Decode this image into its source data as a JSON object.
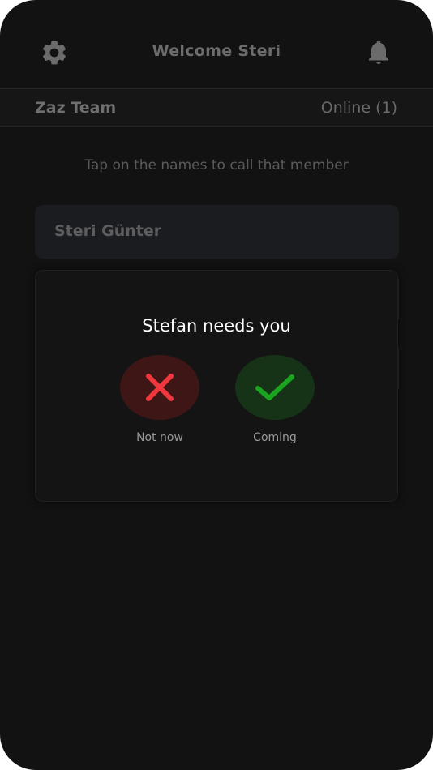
{
  "header": {
    "title": "Welcome Steri",
    "settings_icon": "gear-icon",
    "notifications_icon": "bell-icon"
  },
  "team_bar": {
    "team_name": "Zaz Team",
    "online_status": "Online (1)"
  },
  "instruction": "Tap on the names to call that member",
  "members": [
    {
      "name": "Steri Günter"
    }
  ],
  "call_dialog": {
    "message": "Stefan needs you",
    "decline_label": "Not now",
    "accept_label": "Coming",
    "decline_icon": "close-icon",
    "accept_icon": "check-icon"
  },
  "colors": {
    "background": "#121212",
    "decline": "#f0373d",
    "accept": "#1aa41f"
  }
}
